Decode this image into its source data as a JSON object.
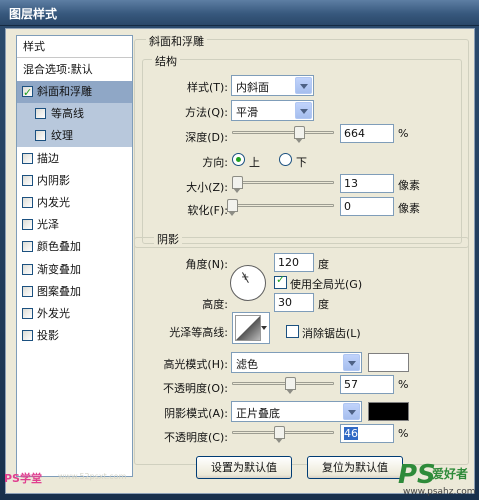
{
  "window": {
    "title": "图层样式"
  },
  "sidebar": {
    "header": "样式",
    "blend": "混合选项:默认",
    "items": [
      {
        "label": "斜面和浮雕",
        "checked": true,
        "selected": true
      },
      {
        "label": "等高线",
        "checked": false,
        "sub": true
      },
      {
        "label": "纹理",
        "checked": false,
        "sub": true
      },
      {
        "label": "描边",
        "checked": false
      },
      {
        "label": "内阴影",
        "checked": false
      },
      {
        "label": "内发光",
        "checked": false
      },
      {
        "label": "光泽",
        "checked": false
      },
      {
        "label": "颜色叠加",
        "checked": false
      },
      {
        "label": "渐变叠加",
        "checked": false
      },
      {
        "label": "图案叠加",
        "checked": false
      },
      {
        "label": "外发光",
        "checked": false
      },
      {
        "label": "投影",
        "checked": false
      }
    ]
  },
  "bevel": {
    "title": "斜面和浮雕",
    "structure": {
      "title": "结构",
      "style_label": "样式(T):",
      "style_value": "内斜面",
      "technique_label": "方法(Q):",
      "technique_value": "平滑",
      "depth_label": "深度(D):",
      "depth_value": "664",
      "depth_unit": "%",
      "depth_level": 0.66,
      "direction_label": "方向:",
      "direction_up": "上",
      "direction_down": "下",
      "direction_selected": "up",
      "size_label": "大小(Z):",
      "size_value": "13",
      "size_unit": "像素",
      "size_level": 0.05,
      "soften_label": "软化(F):",
      "soften_value": "0",
      "soften_unit": "像素",
      "soften_level": 0.0
    },
    "shading": {
      "title": "阴影",
      "angle_label": "角度(N):",
      "angle_value": "120",
      "angle_unit": "度",
      "global_light_label": "使用全局光(G)",
      "global_light_checked": true,
      "altitude_label": "高度:",
      "altitude_value": "30",
      "altitude_unit": "度",
      "contour_label": "光泽等高线:",
      "antialias_label": "消除锯齿(L)",
      "antialias_checked": false,
      "highlight_mode_label": "高光模式(H):",
      "highlight_mode_value": "滤色",
      "highlight_color": "#ffffff",
      "highlight_opacity_label": "不透明度(O):",
      "highlight_opacity_value": "57",
      "highlight_opacity_unit": "%",
      "highlight_opacity_level": 0.57,
      "shadow_mode_label": "阴影模式(A):",
      "shadow_mode_value": "正片叠底",
      "shadow_color": "#000000",
      "shadow_opacity_label": "不透明度(C):",
      "shadow_opacity_value": "46",
      "shadow_opacity_unit": "%",
      "shadow_opacity_level": 0.46
    }
  },
  "buttons": {
    "make_default": "设置为默认值",
    "reset_default": "复位为默认值"
  },
  "watermarks": {
    "left": "PS学堂",
    "left_url": "www.52psxt.com",
    "ps": "PS",
    "cn": "爱好者",
    "url": "www.psahz.com"
  }
}
